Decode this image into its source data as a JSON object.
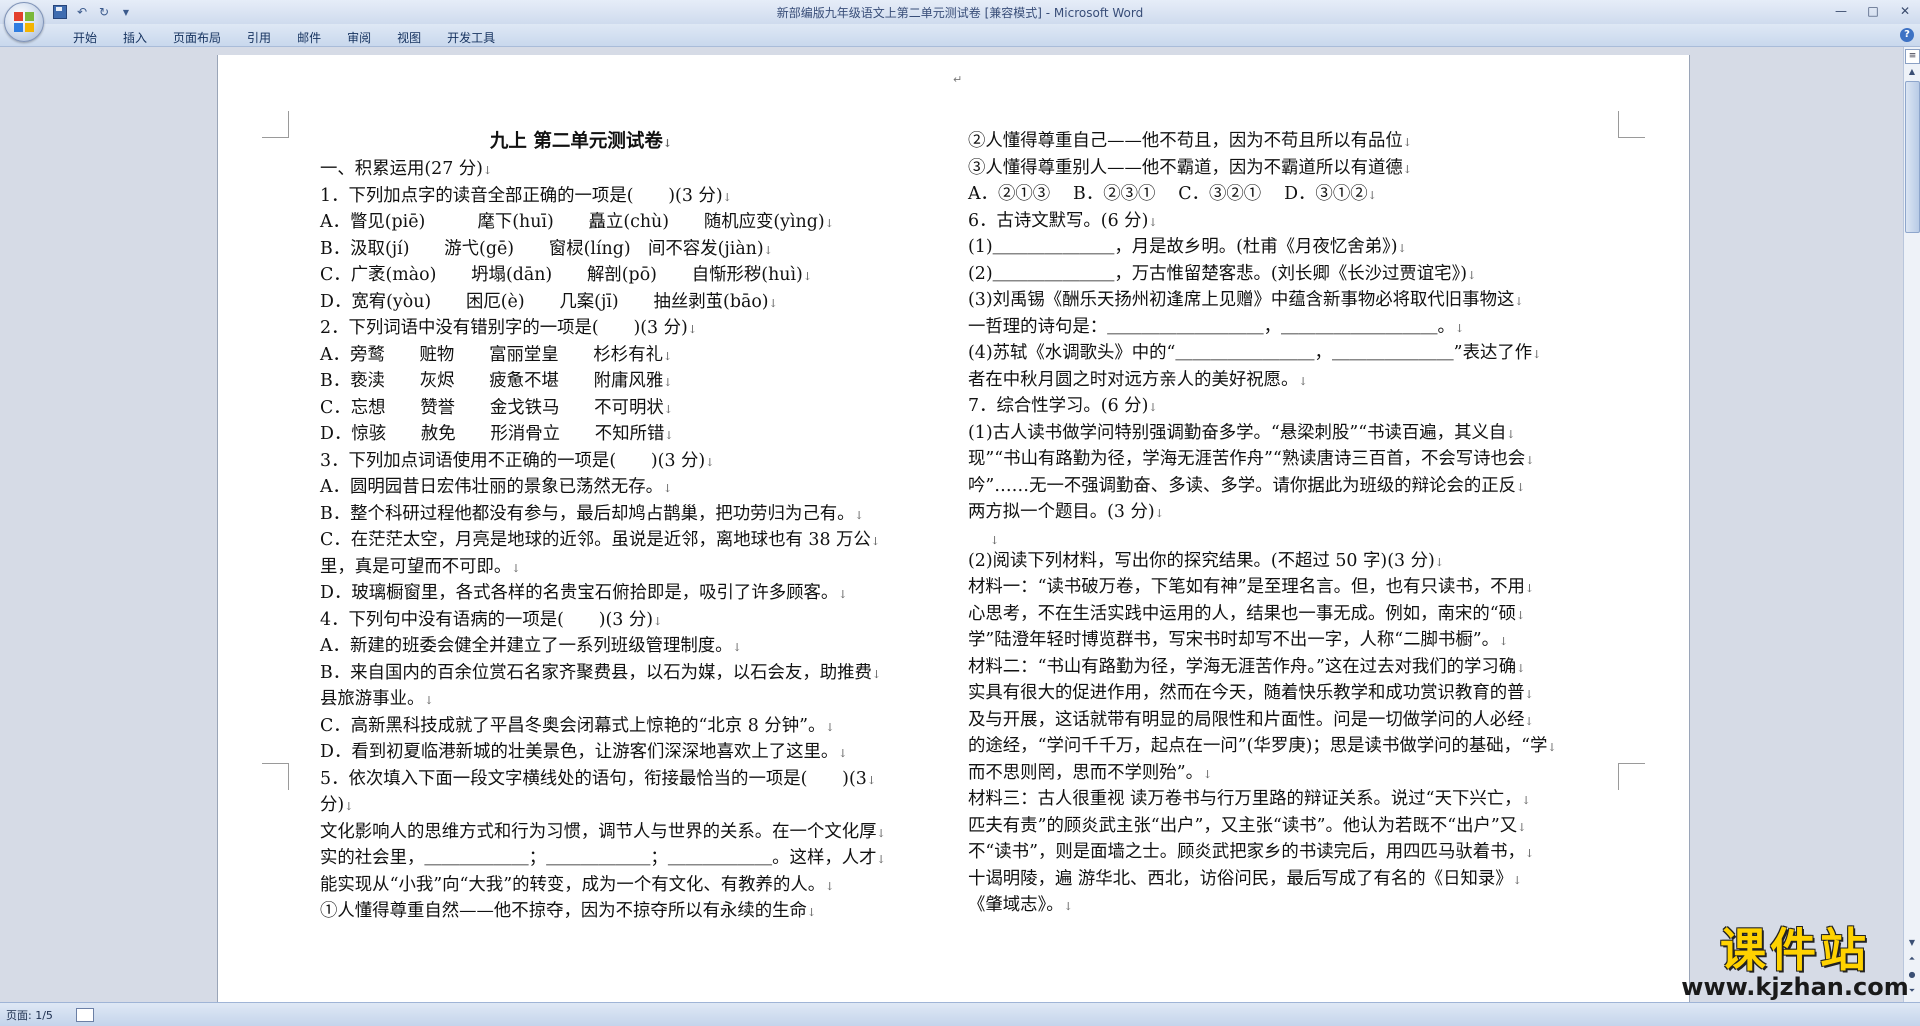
{
  "window": {
    "title": "新部编版九年级语文上第二单元测试卷 [兼容模式] - Microsoft Word"
  },
  "quick_access": {
    "items": [
      "save-icon",
      "undo-icon",
      "redo-icon",
      "customize-icon"
    ]
  },
  "ribbon": {
    "tabs": [
      "开始",
      "插入",
      "页面布局",
      "引用",
      "邮件",
      "审阅",
      "视图",
      "开发工具"
    ]
  },
  "document": {
    "title": "九上 第二单元测试卷",
    "left_column": [
      "一、积累运用(27 分)",
      "1．下列加点字的读音全部正确的一项是(　　)(3 分)",
      "A．瞥见(piē)　　　麾下(huī)　　矗立(chù)　　随机应变(yìng)",
      "B．汲取(jí)　　游弋(gē)　　窗棂(líng)　间不容发(jiàn)",
      "C．广袤(mào)　　坍塌(dān)　　解剖(pō)　　自惭形秽(huì)",
      "D．宽宥(yòu)　　困厄(è)　　几案(jī)　　抽丝剥茧(bāo)",
      "2．下列词语中没有错别字的一项是(　　)(3 分)",
      "A．旁鹜　　赃物　　富丽堂皇　　杉杉有礼",
      "B．亵渎　　灰烬　　疲惫不堪　　附庸风雅",
      "C．忘想　　赞誉　　金戈铁马　　不可明状",
      "D．惊骇　　赦免　　形消骨立　　不知所错",
      "3．下列加点词语使用不正确的一项是(　　)(3 分)",
      "A．圆明园昔日宏伟壮丽的景象已荡然无存。",
      "B．整个科研过程他都没有参与，最后却鸠占鹊巢，把功劳归为己有。",
      "C．在茫茫太空，月亮是地球的近邻。虽说是近邻，离地球也有 38 万公",
      "里，真是可望而不可即。",
      "D．玻璃橱窗里，各式各样的名贵宝石俯拾即是，吸引了许多顾客。",
      "4．下列句中没有语病的一项是(　　)(3 分)",
      "A．新建的班委会健全并建立了一系列班级管理制度。",
      "B．来自国内的百余位赏石名家齐聚费县，以石为媒，以石会友，助推费",
      "县旅游事业。",
      "C．高新黑科技成就了平昌冬奥会闭幕式上惊艳的“北京 8 分钟”。",
      "D．看到初夏临港新城的壮美景色，让游客们深深地喜欢上了这里。",
      "5．依次填入下面一段文字横线处的语句，衔接最恰当的一项是(　　)(3",
      "分)",
      "文化影响人的思维方式和行为习惯，调节人与世界的关系。在一个文化厚",
      "实的社会里，＿＿＿＿＿＿；＿＿＿＿＿＿；＿＿＿＿＿＿。这样，人才",
      "能实现从“小我”向“大我”的转变，成为一个有文化、有教养的人。",
      "①人懂得尊重自然——他不掠夺，因为不掠夺所以有永续的生命"
    ],
    "right_column": [
      "②人懂得尊重自己——他不苟且，因为不苟且所以有品位",
      "③人懂得尊重别人——他不霸道，因为不霸道所以有道德",
      "A．②①③　 B．②③①　 C．③②①　 D．③①②",
      "6．古诗文默写。(6 分)",
      "(1)＿＿＿＿＿＿＿，月是故乡明。(杜甫《月夜忆舍弟》)",
      "(2)＿＿＿＿＿＿＿，万古惟留楚客悲。(刘长卿《长沙过贾谊宅》)",
      "(3)刘禹锡《酬乐天扬州初逢席上见赠》中蕴含新事物必将取代旧事物这",
      "一哲理的诗句是：＿＿＿＿＿＿＿＿＿，＿＿＿＿＿＿＿＿＿。",
      "(4)苏轼《水调歌头》中的“＿＿＿＿＿＿＿＿，＿＿＿＿＿＿＿”表达了作",
      "者在中秋月圆之时对远方亲人的美好祝愿。",
      "7．综合性学习。(6 分)",
      "(1)古人读书做学问特别强调勤奋多学。“悬梁刺股”“书读百遍，其义自",
      "现”“书山有路勤为径，学海无涯苦作舟”“熟读唐诗三百首，不会写诗也会",
      "吟”……无一不强调勤奋、多读、多学。请你据此为班级的辩论会的正反",
      "两方拟一个题目。(3 分)",
      "",
      "(2)阅读下列材料，写出你的探究结果。(不超过 50 字)(3 分)",
      "材料一：“读书破万卷，下笔如有神”是至理名言。但，也有只读书，不用",
      "心思考，不在生活实践中运用的人，结果也一事无成。例如，南宋的“硕",
      "学”陆澄年轻时博览群书，写宋书时却写不出一字，人称“二脚书橱”。",
      "材料二：“书山有路勤为径，学海无涯苦作舟。”这在过去对我们的学习确",
      "实具有很大的促进作用，然而在今天，随着快乐教学和成功赏识教育的普",
      "及与开展，这话就带有明显的局限性和片面性。问是一切做学问的人必经",
      "的途经，“学问千千万，起点在一问”(华罗庚)；思是读书做学问的基础，“学",
      "而不思则罔，思而不学则殆”。",
      "材料三：古人很重视 读万卷书与行万里路的辩证关系。说过“天下兴亡，",
      "匹夫有责”的顾炎武主张“出户”，又主张“读书”。他认为若既不“出户”又",
      "不“读书”，则是面墙之士。顾炎武把家乡的书读完后，用四匹马驮着书，",
      "十谒明陵，遍 游华北、西北，访俗问民，最后写成了有名的《日知录》",
      "《肇域志》。"
    ]
  },
  "status_bar": {
    "page": "页面: 1/5"
  },
  "watermark": {
    "main": "课件站",
    "url": "www.kjzhan.com"
  }
}
